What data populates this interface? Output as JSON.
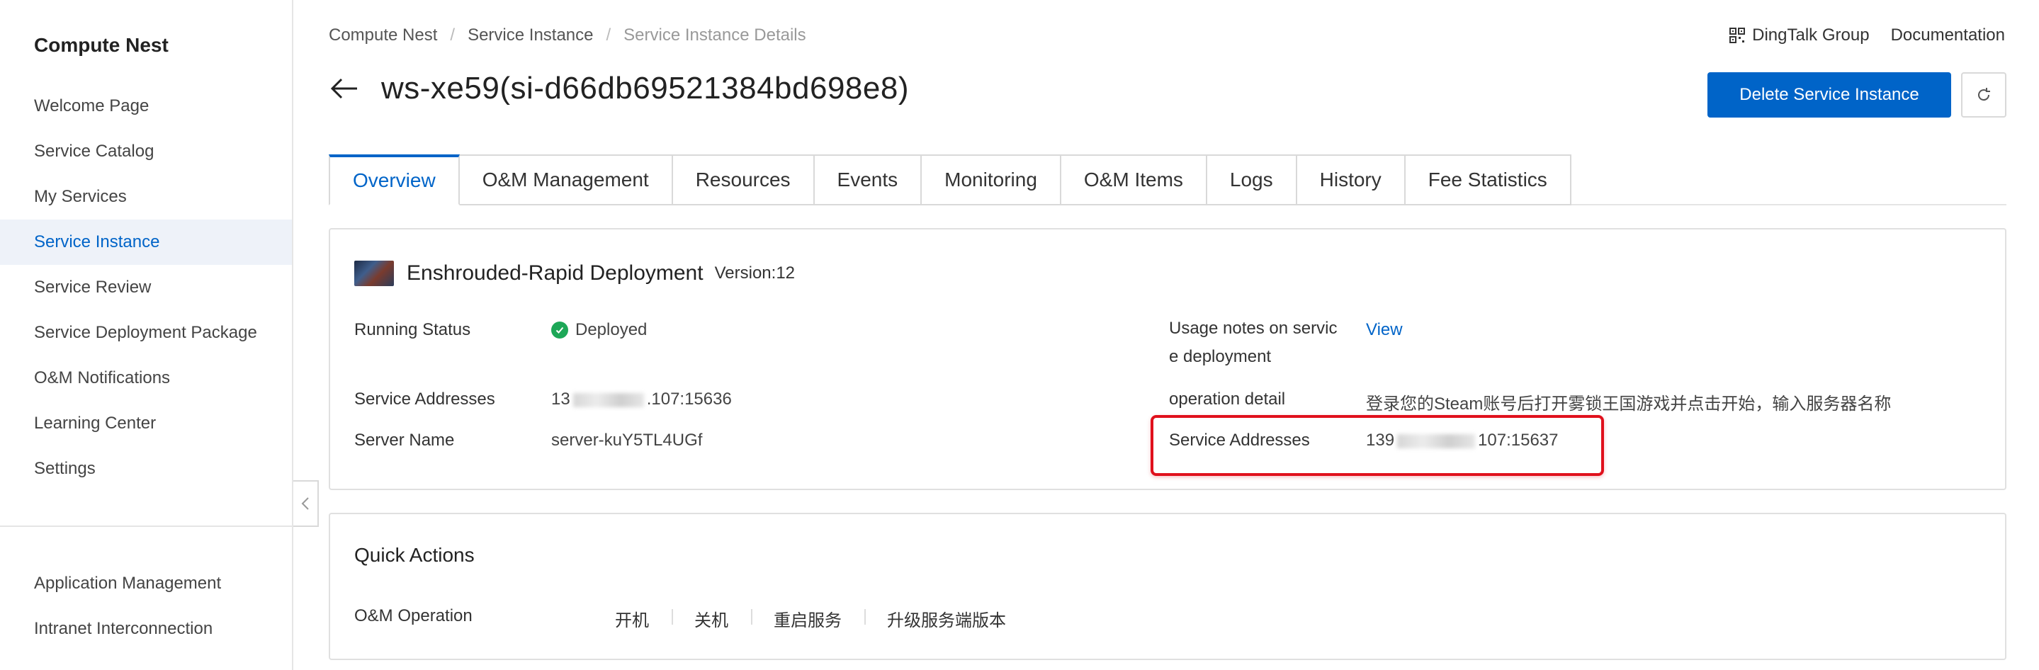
{
  "sidebar": {
    "title": "Compute Nest",
    "items": [
      {
        "label": "Welcome Page",
        "active": false
      },
      {
        "label": "Service Catalog",
        "active": false
      },
      {
        "label": "My Services",
        "active": false
      },
      {
        "label": "Service Instance",
        "active": true
      },
      {
        "label": "Service Review",
        "active": false
      },
      {
        "label": "Service Deployment Package",
        "active": false
      },
      {
        "label": "O&M Notifications",
        "active": false
      },
      {
        "label": "Learning Center",
        "active": false
      },
      {
        "label": "Settings",
        "active": false
      }
    ],
    "bottom_items": [
      {
        "label": "Application Management"
      },
      {
        "label": "Intranet Interconnection"
      }
    ]
  },
  "breadcrumb": [
    "Compute Nest",
    "Service Instance",
    "Service Instance Details"
  ],
  "top_links": {
    "dingtalk": "DingTalk Group",
    "docs": "Documentation"
  },
  "page": {
    "title": "ws-xe59(si-d66db69521384bd698e8)"
  },
  "buttons": {
    "delete": "Delete Service Instance"
  },
  "tabs": [
    "Overview",
    "O&M Management",
    "Resources",
    "Events",
    "Monitoring",
    "O&M Items",
    "Logs",
    "History",
    "Fee Statistics"
  ],
  "active_tab": "Overview",
  "service": {
    "name": "Enshrouded-Rapid Deployment",
    "version": "Version:12"
  },
  "details": {
    "running_status_label": "Running Status",
    "running_status_value": "Deployed",
    "service_addresses_label": "Service Addresses",
    "service_addresses_prefix": "13",
    "service_addresses_suffix": ".107:15636",
    "server_name_label": "Server Name",
    "server_name_value": "server-kuY5TL4UGf",
    "usage_notes_label_line1": "Usage notes on servic",
    "usage_notes_label_line2": "e deployment",
    "usage_notes_value": "View",
    "operation_detail_label": "operation detail",
    "operation_detail_value": "登录您的Steam账号后打开雾锁王国游戏并点击开始，输入服务器名称",
    "service_addresses2_label": "Service Addresses",
    "service_addresses2_prefix": "139",
    "service_addresses2_suffix": "107:15637"
  },
  "quick_actions": {
    "title": "Quick Actions",
    "label": "O&M Operation",
    "actions": [
      "开机",
      "关机",
      "重启服务",
      "升级服务端版本"
    ]
  },
  "colors": {
    "accent": "#0064c8",
    "status_ok": "#1da757",
    "highlight": "#e0101c"
  }
}
